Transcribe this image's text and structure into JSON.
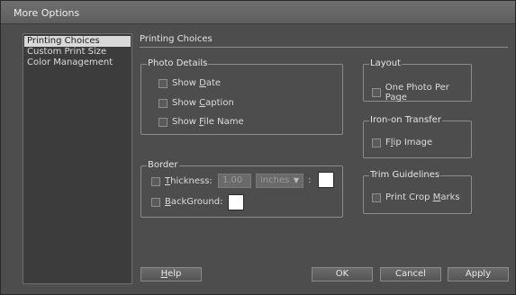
{
  "window": {
    "title": "More Options"
  },
  "sidebar": {
    "items": [
      {
        "label": "Printing Choices",
        "selected": true
      },
      {
        "label": "Custom Print Size",
        "selected": false
      },
      {
        "label": "Color Management",
        "selected": false
      }
    ]
  },
  "main": {
    "section_title": "Printing Choices",
    "photo_details": {
      "legend": "Photo Details",
      "show_date": {
        "pre": "Show ",
        "key": "D",
        "post": "ate",
        "checked": false
      },
      "show_caption": {
        "pre": "Show ",
        "key": "C",
        "post": "aption",
        "checked": false
      },
      "show_file_name": {
        "pre": "Show ",
        "key": "F",
        "post": "ile Name",
        "checked": false
      }
    },
    "border": {
      "legend": "Border",
      "thickness": {
        "pre": "",
        "key": "T",
        "post": "hickness:",
        "checked": false
      },
      "thickness_value": "1.00",
      "units": "inches",
      "colon": ":",
      "background": {
        "pre": "",
        "key": "B",
        "post": "ackGround:",
        "checked": false
      }
    },
    "layout": {
      "legend": "Layout",
      "one_photo_per_page": {
        "label": "One Photo Per Page",
        "checked": false
      }
    },
    "iron_on": {
      "legend": "Iron-on Transfer",
      "flip_image": {
        "pre": "F",
        "key": "l",
        "post": "ip Image",
        "checked": false
      }
    },
    "trim": {
      "legend": "Trim Guidelines",
      "print_crop_marks": {
        "pre": "Print Crop ",
        "key": "M",
        "post": "arks",
        "checked": false
      }
    }
  },
  "buttons": {
    "help": {
      "pre": "",
      "key": "H",
      "post": "elp"
    },
    "ok": "OK",
    "cancel": "Cancel",
    "apply": "Apply"
  },
  "colors": {
    "dialog_bg": "#4d4d4d",
    "sidebar_bg": "#3c3c3c",
    "selection_bg": "#d9d9d9",
    "swatch": "#ffffff"
  }
}
